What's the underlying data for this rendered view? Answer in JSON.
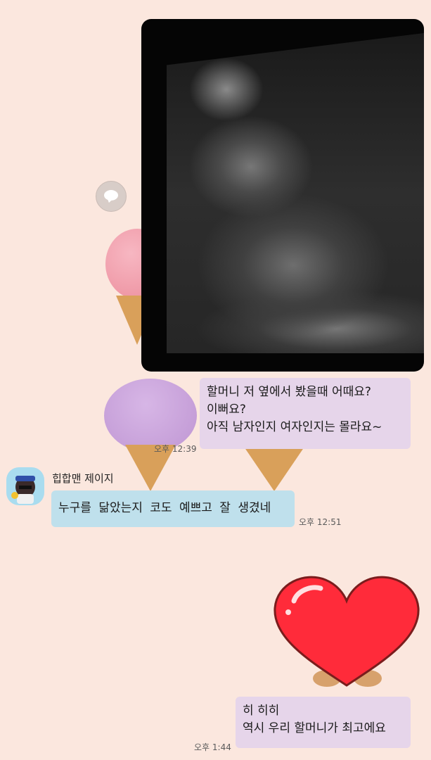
{
  "messages": [
    {
      "id": "photo",
      "type": "image",
      "alt": "ultrasound"
    },
    {
      "id": "m1",
      "type": "text",
      "lines": [
        "할머니 저 옆에서 봤을때 어때요?",
        "이뻐요?",
        "아직 남자인지 여자인지는 몰라요~"
      ],
      "time": "오후 12:39"
    },
    {
      "id": "m2",
      "type": "text",
      "sender": "힙합맨 제이지",
      "text": "누구를 닮았는지 코도 예쁘고 잘 생겼네",
      "time": "오후 12:51"
    },
    {
      "id": "m3",
      "type": "sticker",
      "icon": "heart-icon"
    },
    {
      "id": "m4",
      "type": "text",
      "lines": [
        "히 히히",
        "역시 우리 할머니가 최고에요"
      ],
      "time": "오후 1:44"
    }
  ],
  "colors": {
    "background": "#fbe7de",
    "my_bubble": "#e6d5ea",
    "their_bubble": "#bfe0ec",
    "heart": "#ff2b3a"
  }
}
